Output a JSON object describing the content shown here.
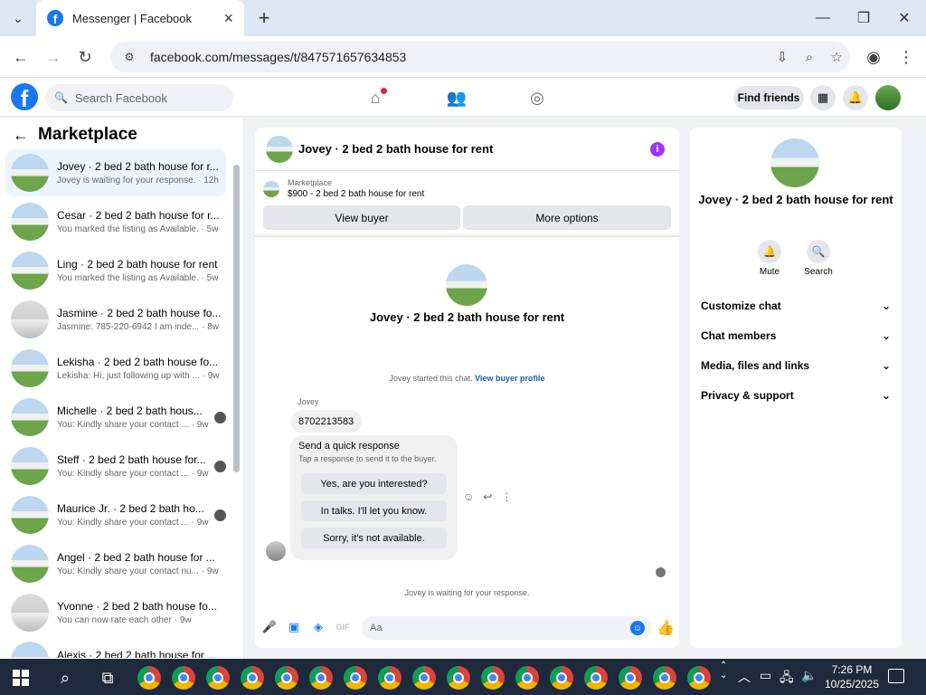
{
  "browser": {
    "tab_title": "Messenger | Facebook",
    "url": "facebook.com/messages/t/847571657634853"
  },
  "fb": {
    "search_placeholder": "Search Facebook",
    "find_friends": "Find friends"
  },
  "sidebar": {
    "title": "Marketplace",
    "conversations": [
      {
        "name": "Jovey · 2 bed 2 bath house for r...",
        "preview": "Jovey is waiting for your response. · 12h"
      },
      {
        "name": "Cesar · 2 bed 2 bath house for r...",
        "preview": "You marked the listing as Available. · 5w"
      },
      {
        "name": "Ling · 2 bed 2 bath house for rent",
        "preview": "You marked the listing as Available. · 5w"
      },
      {
        "name": "Jasmine · 2 bed 2 bath house fo...",
        "preview": "Jasmine: 785-220-6942 I am inde... · 8w"
      },
      {
        "name": "Lekisha · 2 bed 2 bath house fo...",
        "preview": "Lekisha: Hi, just following up with ... · 9w"
      },
      {
        "name": "Michelle · 2 bed 2 bath hous...",
        "preview": "You: Kindly share your contact ... · 9w"
      },
      {
        "name": "Steff · 2 bed 2 bath house for...",
        "preview": "You: Kindly share your contact ... · 9w"
      },
      {
        "name": "Maurice Jr. · 2 bed 2 bath ho...",
        "preview": "You: Kindly share your contact ... · 9w"
      },
      {
        "name": "Angel · 2 bed 2 bath house for ...",
        "preview": "You: Kindly share your contact nu... · 9w"
      },
      {
        "name": "Yvonne · 2 bed 2 bath house fo...",
        "preview": "You can now rate each other · 9w"
      },
      {
        "name": "Alexis · 2 bed 2 bath house for ...",
        "preview": ""
      }
    ]
  },
  "chat": {
    "title": "Jovey · 2 bed 2 bath house for rent",
    "marketplace_label": "Marketplace",
    "listing": "$900 - 2 bed 2 bath house for rent",
    "view_buyer": "View buyer",
    "more_options": "More options",
    "center_name": "Jovey · 2 bed 2 bath house for rent",
    "started_text": "Jovey started this chat.",
    "view_buyer_profile": "View buyer profile",
    "sender": "Jovey",
    "message": "8702213583",
    "quick_title": "Send a quick response",
    "quick_sub": "Tap a response to send it to the buyer.",
    "quick_options": [
      "Yes, are you interested?",
      "In talks. I'll let you know.",
      "Sorry, it's not available."
    ],
    "waiting": "Jovey is waiting for your response.",
    "composer_placeholder": "Aa"
  },
  "details": {
    "name": "Jovey · 2 bed 2 bath house for rent",
    "mute": "Mute",
    "search": "Search",
    "sections": [
      "Customize chat",
      "Chat members",
      "Media, files and links",
      "Privacy & support"
    ]
  },
  "taskbar": {
    "time": "7:26 PM",
    "date": "10/25/2025"
  },
  "colors": {
    "fb_blue": "#1877f2",
    "selected_row": "#ebf5ff",
    "info_purple": "#a033ff"
  }
}
